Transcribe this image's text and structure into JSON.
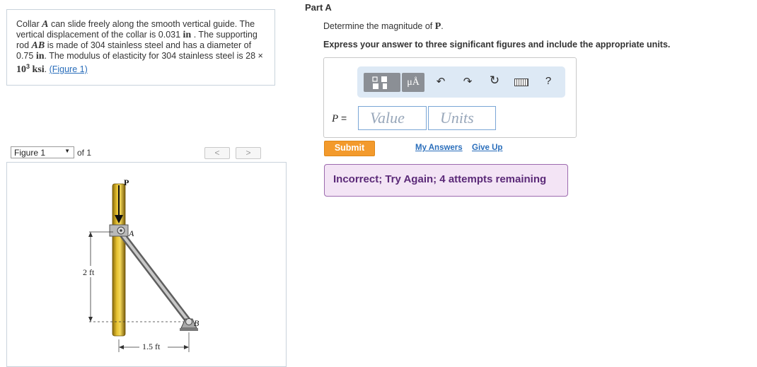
{
  "problem": {
    "t1": "Collar ",
    "v1": "A",
    "t2": " can slide freely along the smooth vertical guide. The vertical displacement of the collar is 0.031 ",
    "u1": "in",
    "t3": " . The supporting rod ",
    "v2": "AB",
    "t4": " is made of 304 stainless steel and has a diameter of 0.75 ",
    "u2": "in",
    "t5": ". The modulus of elasticity for 304 stainless steel is 28 × ",
    "pow": "10",
    "exp": "3",
    "u3": "ksi",
    "t6": ". ",
    "figure_link": "(Figure 1)"
  },
  "figure": {
    "select_value": "Figure 1",
    "of_text": "of 1",
    "prev": "<",
    "next": ">",
    "labels": {
      "P": "P",
      "A": "A",
      "B": "B",
      "height": "2 ft",
      "width": "1.5 ft"
    }
  },
  "part": {
    "title": "Part A",
    "q_prefix": "Determine the magnitude of ",
    "q_var": "P",
    "q_suffix": ".",
    "instruction": "Express your answer to three significant figures and include the appropriate units."
  },
  "toolbar": {
    "units_btn": "μÅ",
    "help": "?"
  },
  "answer": {
    "label_var": "P",
    "label_eq": " =",
    "value_placeholder": "Value",
    "units_placeholder": "Units"
  },
  "actions": {
    "submit": "Submit",
    "my_answers": "My Answers",
    "give_up": "Give Up"
  },
  "feedback": "Incorrect; Try Again; 4 attempts remaining"
}
